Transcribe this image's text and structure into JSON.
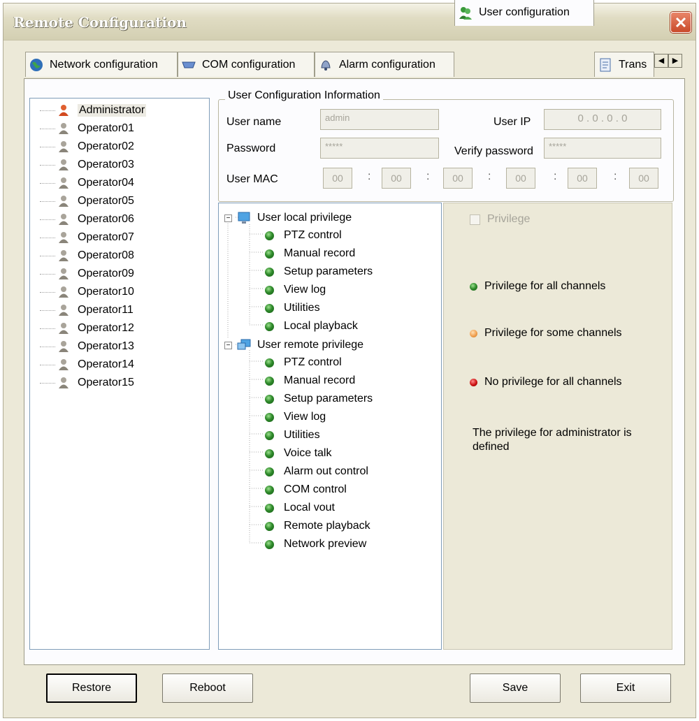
{
  "window": {
    "title": "Remote Configuration"
  },
  "tabs": [
    {
      "label": "Network configuration",
      "icon": "globe-icon"
    },
    {
      "label": "COM configuration",
      "icon": "serial-port-icon"
    },
    {
      "label": "Alarm configuration",
      "icon": "bell-icon"
    },
    {
      "label": "User configuration",
      "icon": "users-icon",
      "active": true
    },
    {
      "label": "Trans",
      "icon": "document-icon"
    }
  ],
  "users": [
    {
      "name": "Administrator",
      "role": "admin",
      "selected": true
    },
    {
      "name": "Operator01"
    },
    {
      "name": "Operator02"
    },
    {
      "name": "Operator03"
    },
    {
      "name": "Operator04"
    },
    {
      "name": "Operator05"
    },
    {
      "name": "Operator06"
    },
    {
      "name": "Operator07"
    },
    {
      "name": "Operator08"
    },
    {
      "name": "Operator09"
    },
    {
      "name": "Operator10"
    },
    {
      "name": "Operator11"
    },
    {
      "name": "Operator12"
    },
    {
      "name": "Operator13"
    },
    {
      "name": "Operator14"
    },
    {
      "name": "Operator15"
    }
  ],
  "user_info": {
    "group_title": "User Configuration Information",
    "username_label": "User name",
    "username_value": "admin",
    "password_label": "Password",
    "password_value": "*****",
    "userip_label": "User IP",
    "userip_value": "0 . 0 . 0 . 0",
    "verify_label": "Verify password",
    "verify_value": "*****",
    "mac_label": "User MAC",
    "mac_values": [
      "00",
      "00",
      "00",
      "00",
      "00",
      "00"
    ],
    "mac_separator": ":"
  },
  "privileges": {
    "local": {
      "label": "User local privilege",
      "items": [
        "PTZ control",
        "Manual record",
        "Setup parameters",
        "View log",
        "Utilities",
        "Local playback"
      ]
    },
    "remote": {
      "label": "User remote privilege",
      "items": [
        "PTZ control",
        "Manual record",
        "Setup parameters",
        "View log",
        "Utilities",
        "Voice talk",
        "Alarm out control",
        "COM control",
        "Local vout",
        "Remote playback",
        "Network preview"
      ]
    },
    "expander_symbol": "−"
  },
  "legend": {
    "privilege_checkbox": "Privilege",
    "all_channels": "Privilege for all channels",
    "some_channels": "Privilege for some channels",
    "no_channels": "No privilege for all channels",
    "note": "The privilege for administrator is defined",
    "colors": {
      "all": "#2f8a2b",
      "some": "#f0a050",
      "none": "#cc1111"
    }
  },
  "buttons": {
    "restore": "Restore",
    "reboot": "Reboot",
    "save": "Save",
    "exit": "Exit"
  },
  "tab_scroll": {
    "left": "◀",
    "right": "▶"
  }
}
